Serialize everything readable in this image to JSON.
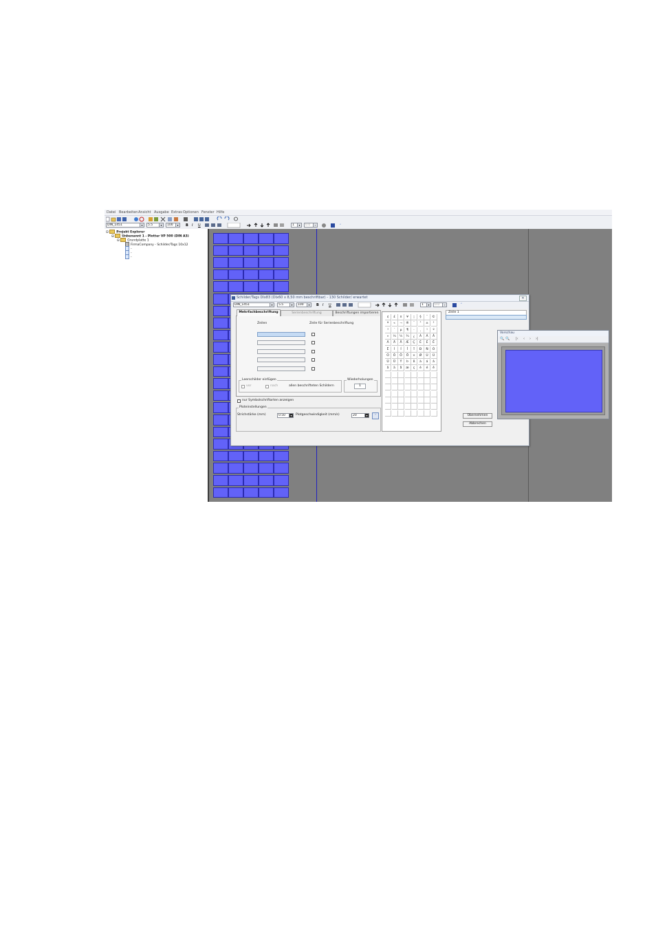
{
  "menu": [
    "Datei",
    "Bearbeiten",
    "Ansicht",
    "Ausgabe",
    "Extras",
    "Optionen",
    "Fenster",
    "Hilfe"
  ],
  "toolbar2": {
    "format": "DIN_1451",
    "size": "5.5",
    "percent": "100",
    "bold": "B",
    "italic": "I",
    "underline": "U",
    "spin_value": "1",
    "spin_value2": "0.0"
  },
  "tree": {
    "root": "Projekt Explorer",
    "project": "Unbenannt 1 - Plotter VP 500 (DIN A3)",
    "plate": "Grundplatte 1",
    "sheet": "FirmaCompany - Schilder/Tags 10x12",
    "items": [
      "-",
      "-",
      "-"
    ]
  },
  "dialog": {
    "title": "Schilder/Tags DIx83 (DIx60 x 8,50 mm beschriftbar) - 130 Schilder/ erwartet",
    "toolbar": {
      "format": "DIN_1451",
      "size": "5.5",
      "percent": "100",
      "bold": "B",
      "italic": "I",
      "underline": "U",
      "spin": "1",
      "spin2": "0.0"
    },
    "tabs": [
      "Mehrfachbeschriftung",
      "Serienbeschriftung",
      "Beschriftungen importieren"
    ],
    "col_zeilen": "Zeilen",
    "col_serie": "Zeile für Serienbeschriftung",
    "leer_group": "Leerschilder einfügen",
    "leer_vor": "vor",
    "leer_nach": "nach",
    "leer_allen": "allen beschrifteten Schildern",
    "wdh_group": "Wiederholungen",
    "wdh_value": "1",
    "nur_symbol": "nur Symbolschriftarten anzeigen",
    "plot_group": "Ploteinstellungen",
    "strich_label": "Strichstärke (mm)",
    "strich_value": "0.50",
    "speed_label": "Plotgeschwindigkeit (mm/s)",
    "speed_value": "20",
    "zeile_header": "Zeile 1",
    "btn_ok": "Übernehmen",
    "btn_cancel": "Abbrechen"
  },
  "symbols": [
    [
      "¢",
      "£",
      "¤",
      "¥",
      "¦",
      "§",
      "¨",
      "©"
    ],
    [
      "ª",
      "«",
      "¬",
      "®",
      "¯",
      "°",
      "±",
      "²"
    ],
    [
      "³",
      "´",
      "µ",
      "¶",
      "·",
      "¸",
      "¹",
      "º"
    ],
    [
      "»",
      "¼",
      "½",
      "¾",
      "¿",
      "À",
      "Á",
      "Â"
    ],
    [
      "Ã",
      "Ä",
      "Å",
      "Æ",
      "Ç",
      "È",
      "É",
      "Ê"
    ],
    [
      "Ë",
      "Ì",
      "Í",
      "Î",
      "Ï",
      "Ð",
      "Ñ",
      "Ò"
    ],
    [
      "Ó",
      "Ô",
      "Õ",
      "Ö",
      "×",
      "Ø",
      "Ù",
      "Ú"
    ],
    [
      "Û",
      "Ü",
      "Ý",
      "Þ",
      "ß",
      "à",
      "á",
      "â"
    ],
    [
      "ã",
      "ä",
      "å",
      "æ",
      "ç",
      "è",
      "é",
      "ê"
    ]
  ],
  "preview": {
    "title": "Vorschau"
  },
  "colors": {
    "label_fill": "#6262f8",
    "canvas": "#808080"
  }
}
